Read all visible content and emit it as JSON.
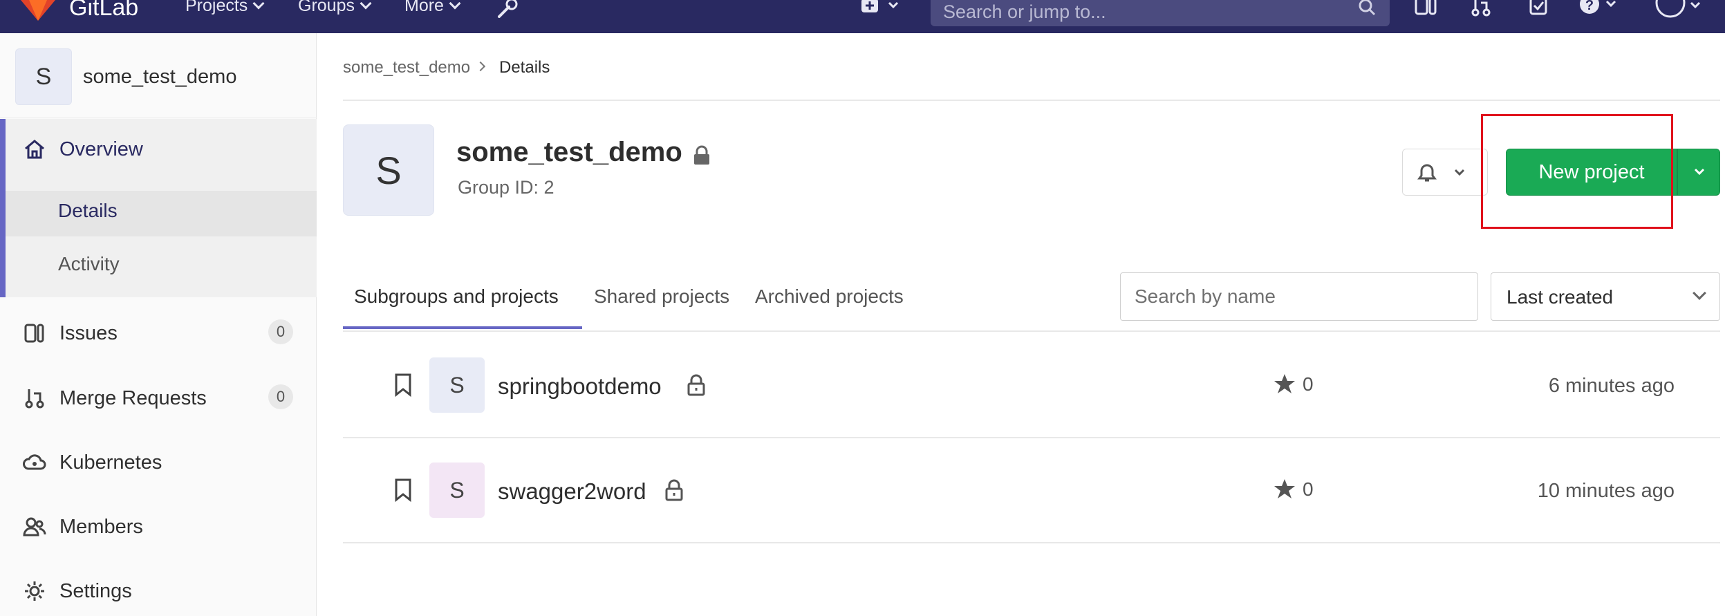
{
  "navbar": {
    "brand": "GitLab",
    "menus": [
      {
        "label": "Projects"
      },
      {
        "label": "Groups"
      },
      {
        "label": "More"
      }
    ],
    "search_placeholder": "Search or jump to..."
  },
  "sidebar": {
    "avatar_letter": "S",
    "group_name": "some_test_demo",
    "overview": "Overview",
    "details": "Details",
    "activity": "Activity",
    "items": [
      {
        "label": "Issues",
        "count": "0"
      },
      {
        "label": "Merge Requests",
        "count": "0"
      },
      {
        "label": "Kubernetes"
      },
      {
        "label": "Members"
      },
      {
        "label": "Settings"
      }
    ]
  },
  "breadcrumb": {
    "group": "some_test_demo",
    "current": "Details"
  },
  "group": {
    "avatar_letter": "S",
    "title": "some_test_demo",
    "id_text": "Group ID: 2"
  },
  "actions": {
    "new_project": "New project"
  },
  "tabs": [
    {
      "label": "Subgroups and projects",
      "active": true
    },
    {
      "label": "Shared projects"
    },
    {
      "label": "Archived projects"
    }
  ],
  "filter": {
    "placeholder": "Search by name",
    "sort": "Last created"
  },
  "projects": [
    {
      "letter": "S",
      "name": "springbootdemo",
      "stars": "0",
      "updated": "6 minutes ago",
      "avatar_color": "#e8ebf6"
    },
    {
      "letter": "S",
      "name": "swagger2word",
      "stars": "0",
      "updated": "10 minutes ago",
      "avatar_color": "#f3e6f5"
    }
  ],
  "colors": {
    "navbar": "#292961",
    "accent": "#6666c4",
    "success": "#1aaa55",
    "highlight_box": "#e0121c"
  }
}
